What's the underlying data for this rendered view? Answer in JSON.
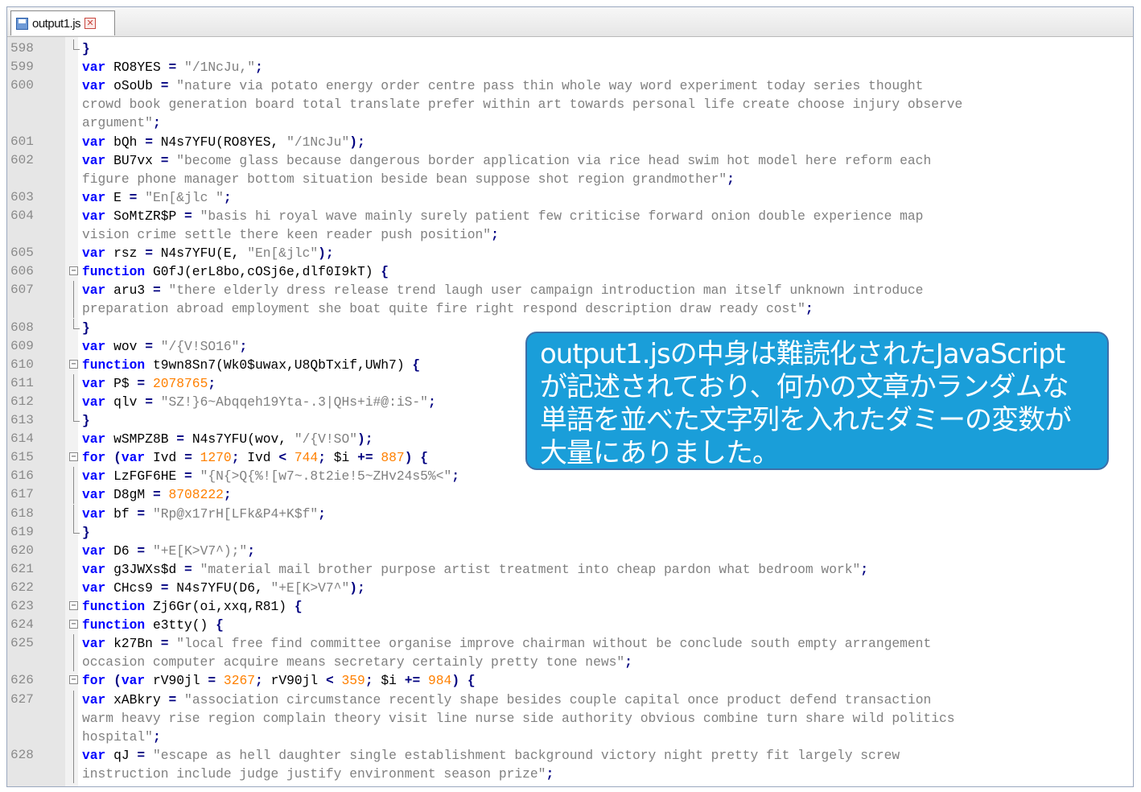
{
  "tab": {
    "title": "output1.js"
  },
  "lines": [
    {
      "num": "598",
      "fold": "end",
      "parts": [
        [
          "op",
          "}"
        ]
      ]
    },
    {
      "num": "599",
      "parts": [
        [
          "kw",
          "var "
        ],
        [
          "",
          "RO8YES "
        ],
        [
          "op",
          "= "
        ],
        [
          "str",
          "\"/1NcJu,\""
        ],
        [
          "op",
          ";"
        ]
      ]
    },
    {
      "num": "600",
      "parts": [
        [
          "kw",
          "var "
        ],
        [
          "",
          "oSoUb "
        ],
        [
          "op",
          "= "
        ],
        [
          "str",
          "\"nature via potato energy order centre pass thin whole way word experiment today series thought"
        ]
      ]
    },
    {
      "num": "",
      "parts": [
        [
          "str",
          "crowd book generation board total translate prefer within art towards personal life create choose injury observe"
        ]
      ]
    },
    {
      "num": "",
      "parts": [
        [
          "str",
          "argument\""
        ],
        [
          "op",
          ";"
        ]
      ]
    },
    {
      "num": "601",
      "parts": [
        [
          "kw",
          "var "
        ],
        [
          "",
          "bQh "
        ],
        [
          "op",
          "= "
        ],
        [
          "",
          "N4s7YFU(RO8YES, "
        ],
        [
          "str",
          "\"/1NcJu\""
        ],
        [
          "op",
          ");"
        ]
      ]
    },
    {
      "num": "602",
      "parts": [
        [
          "kw",
          "var "
        ],
        [
          "",
          "BU7vx "
        ],
        [
          "op",
          "= "
        ],
        [
          "str",
          "\"become glass because dangerous border application via rice head swim hot model here reform each"
        ]
      ]
    },
    {
      "num": "",
      "parts": [
        [
          "str",
          "figure phone manager bottom situation beside bean suppose shot region grandmother\""
        ],
        [
          "op",
          ";"
        ]
      ]
    },
    {
      "num": "603",
      "parts": [
        [
          "kw",
          "var "
        ],
        [
          "",
          "E "
        ],
        [
          "op",
          "= "
        ],
        [
          "str",
          "\"En[&jlc \""
        ],
        [
          "op",
          ";"
        ]
      ]
    },
    {
      "num": "604",
      "parts": [
        [
          "kw",
          "var "
        ],
        [
          "",
          "SoMtZR$P "
        ],
        [
          "op",
          "= "
        ],
        [
          "str",
          "\"basis hi royal wave mainly surely patient few criticise forward onion double experience map"
        ]
      ]
    },
    {
      "num": "",
      "parts": [
        [
          "str",
          "vision crime settle there keen reader push position\""
        ],
        [
          "op",
          ";"
        ]
      ]
    },
    {
      "num": "605",
      "parts": [
        [
          "kw",
          "var "
        ],
        [
          "",
          "rsz "
        ],
        [
          "op",
          "= "
        ],
        [
          "",
          "N4s7YFU(E, "
        ],
        [
          "str",
          "\"En[&jlc\""
        ],
        [
          "op",
          ");"
        ]
      ]
    },
    {
      "num": "606",
      "fold": "start",
      "parts": [
        [
          "kw",
          "function "
        ],
        [
          "",
          "G0fJ(erL8bo,cOSj6e,dlf0I9kT) "
        ],
        [
          "op",
          "{"
        ]
      ]
    },
    {
      "num": "607",
      "fold": "line",
      "parts": [
        [
          "kw",
          "var "
        ],
        [
          "",
          "aru3 "
        ],
        [
          "op",
          "= "
        ],
        [
          "str",
          "\"there elderly dress release trend laugh user campaign introduction man itself unknown introduce"
        ]
      ]
    },
    {
      "num": "",
      "fold": "line",
      "parts": [
        [
          "str",
          "preparation abroad employment she boat quite fire right respond description draw ready cost\""
        ],
        [
          "op",
          ";"
        ]
      ]
    },
    {
      "num": "608",
      "fold": "end",
      "parts": [
        [
          "op",
          "}"
        ]
      ]
    },
    {
      "num": "609",
      "parts": [
        [
          "kw",
          "var "
        ],
        [
          "",
          "wov "
        ],
        [
          "op",
          "= "
        ],
        [
          "str",
          "\"/{V!SO16\""
        ],
        [
          "op",
          ";"
        ]
      ]
    },
    {
      "num": "610",
      "fold": "start",
      "parts": [
        [
          "kw",
          "function "
        ],
        [
          "",
          "t9wn8Sn7(Wk0$uwax,U8QbTxif,UWh7) "
        ],
        [
          "op",
          "{"
        ]
      ]
    },
    {
      "num": "611",
      "fold": "line",
      "parts": [
        [
          "kw",
          "var "
        ],
        [
          "",
          "P$ "
        ],
        [
          "op",
          "= "
        ],
        [
          "num",
          "2078765"
        ],
        [
          "op",
          ";"
        ]
      ]
    },
    {
      "num": "612",
      "fold": "line",
      "parts": [
        [
          "kw",
          "var "
        ],
        [
          "",
          "qlv "
        ],
        [
          "op",
          "= "
        ],
        [
          "str",
          "\"SZ!}6~Abqqeh19Yta-.3|QHs+i#@:iS-\""
        ],
        [
          "op",
          ";"
        ]
      ]
    },
    {
      "num": "613",
      "fold": "end",
      "parts": [
        [
          "op",
          "}"
        ]
      ]
    },
    {
      "num": "614",
      "parts": [
        [
          "kw",
          "var "
        ],
        [
          "",
          "wSMPZ8B "
        ],
        [
          "op",
          "= "
        ],
        [
          "",
          "N4s7YFU(wov, "
        ],
        [
          "str",
          "\"/{V!SO\""
        ],
        [
          "op",
          ");"
        ]
      ]
    },
    {
      "num": "615",
      "fold": "start",
      "parts": [
        [
          "kw",
          "for "
        ],
        [
          "op",
          "("
        ],
        [
          "kw",
          "var "
        ],
        [
          "",
          "Ivd "
        ],
        [
          "op",
          "= "
        ],
        [
          "num",
          "1270"
        ],
        [
          "op",
          "; "
        ],
        [
          "",
          "Ivd "
        ],
        [
          "op",
          "< "
        ],
        [
          "num",
          "744"
        ],
        [
          "op",
          "; "
        ],
        [
          "",
          "$i "
        ],
        [
          "op",
          "+= "
        ],
        [
          "num",
          "887"
        ],
        [
          "op",
          ") {"
        ]
      ]
    },
    {
      "num": "616",
      "fold": "line",
      "parts": [
        [
          "kw",
          "var "
        ],
        [
          "",
          "LzFGF6HE "
        ],
        [
          "op",
          "= "
        ],
        [
          "str",
          "\"{N{>Q{%![w7~.8t2ie!5~ZHv24s5%<\""
        ],
        [
          "op",
          ";"
        ]
      ]
    },
    {
      "num": "617",
      "fold": "line",
      "parts": [
        [
          "kw",
          "var "
        ],
        [
          "",
          "D8gM "
        ],
        [
          "op",
          "= "
        ],
        [
          "num",
          "8708222"
        ],
        [
          "op",
          ";"
        ]
      ]
    },
    {
      "num": "618",
      "fold": "line",
      "parts": [
        [
          "kw",
          "var "
        ],
        [
          "",
          "bf "
        ],
        [
          "op",
          "= "
        ],
        [
          "str",
          "\"Rp@x17rH[LFk&P4+K$f\""
        ],
        [
          "op",
          ";"
        ]
      ]
    },
    {
      "num": "619",
      "fold": "end",
      "parts": [
        [
          "op",
          "}"
        ]
      ]
    },
    {
      "num": "620",
      "parts": [
        [
          "kw",
          "var "
        ],
        [
          "",
          "D6 "
        ],
        [
          "op",
          "= "
        ],
        [
          "str",
          "\"+E[K>V7^);\""
        ],
        [
          "op",
          ";"
        ]
      ]
    },
    {
      "num": "621",
      "parts": [
        [
          "kw",
          "var "
        ],
        [
          "",
          "g3JWXs$d "
        ],
        [
          "op",
          "= "
        ],
        [
          "str",
          "\"material mail brother purpose artist treatment into cheap pardon what bedroom work\""
        ],
        [
          "op",
          ";"
        ]
      ]
    },
    {
      "num": "622",
      "parts": [
        [
          "kw",
          "var "
        ],
        [
          "",
          "CHcs9 "
        ],
        [
          "op",
          "= "
        ],
        [
          "",
          "N4s7YFU(D6, "
        ],
        [
          "str",
          "\"+E[K>V7^\""
        ],
        [
          "op",
          ");"
        ]
      ]
    },
    {
      "num": "623",
      "fold": "start",
      "parts": [
        [
          "kw",
          "function "
        ],
        [
          "",
          "Zj6Gr(oi,xxq,R81) "
        ],
        [
          "op",
          "{"
        ]
      ]
    },
    {
      "num": "624",
      "fold": "start",
      "parts": [
        [
          "kw",
          "function "
        ],
        [
          "",
          "e3tty() "
        ],
        [
          "op",
          "{"
        ]
      ]
    },
    {
      "num": "625",
      "fold": "line",
      "parts": [
        [
          "kw",
          "var "
        ],
        [
          "",
          "k27Bn "
        ],
        [
          "op",
          "= "
        ],
        [
          "str",
          "\"local free find committee organise improve chairman without be conclude south empty arrangement"
        ]
      ]
    },
    {
      "num": "",
      "fold": "line",
      "parts": [
        [
          "str",
          "occasion computer acquire means secretary certainly pretty tone news\""
        ],
        [
          "op",
          ";"
        ]
      ]
    },
    {
      "num": "626",
      "fold": "start",
      "parts": [
        [
          "kw",
          "for "
        ],
        [
          "op",
          "("
        ],
        [
          "kw",
          "var "
        ],
        [
          "",
          "rV90jl "
        ],
        [
          "op",
          "= "
        ],
        [
          "num",
          "3267"
        ],
        [
          "op",
          "; "
        ],
        [
          "",
          "rV90jl "
        ],
        [
          "op",
          "< "
        ],
        [
          "num",
          "359"
        ],
        [
          "op",
          "; "
        ],
        [
          "",
          "$i "
        ],
        [
          "op",
          "+= "
        ],
        [
          "num",
          "984"
        ],
        [
          "op",
          ") {"
        ]
      ]
    },
    {
      "num": "627",
      "fold": "line",
      "parts": [
        [
          "kw",
          "var "
        ],
        [
          "",
          "xABkry "
        ],
        [
          "op",
          "= "
        ],
        [
          "str",
          "\"association circumstance recently shape besides couple capital once product defend transaction"
        ]
      ]
    },
    {
      "num": "",
      "fold": "line",
      "parts": [
        [
          "str",
          "warm heavy rise region complain theory visit line nurse side authority obvious combine turn share wild politics"
        ]
      ]
    },
    {
      "num": "",
      "fold": "line",
      "parts": [
        [
          "str",
          "hospital\""
        ],
        [
          "op",
          ";"
        ]
      ]
    },
    {
      "num": "628",
      "fold": "line",
      "parts": [
        [
          "kw",
          "var "
        ],
        [
          "",
          "qJ "
        ],
        [
          "op",
          "= "
        ],
        [
          "str",
          "\"escape as hell daughter single establishment background victory night pretty fit largely screw"
        ]
      ]
    },
    {
      "num": "",
      "fold": "line",
      "parts": [
        [
          "str",
          "instruction include judge justify environment season prize\""
        ],
        [
          "op",
          ";"
        ]
      ]
    }
  ],
  "callout": {
    "lines": [
      "output1.jsの中身は難読化されたJavaScript",
      "が記述されており、何かの文章かランダムな",
      "単語を並べた文字列を入れたダミーの変数が",
      "大量にありました。"
    ]
  }
}
